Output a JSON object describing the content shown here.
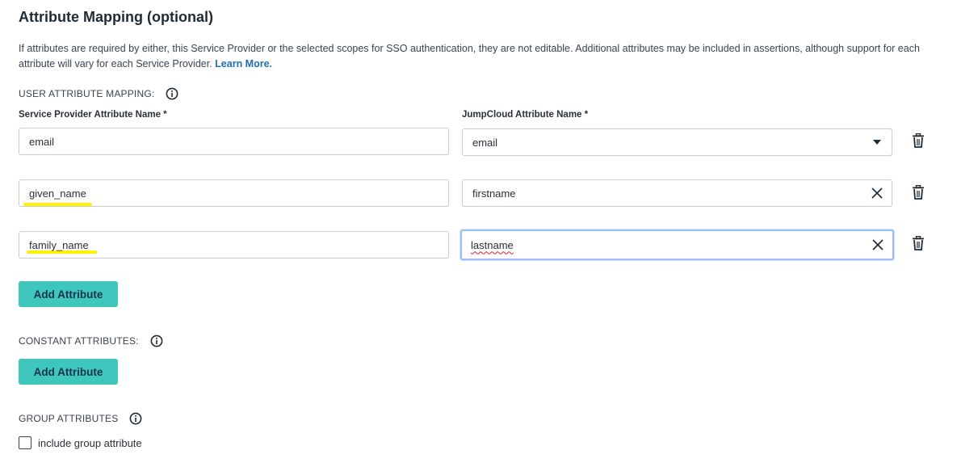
{
  "heading": "Attribute Mapping (optional)",
  "description": {
    "text": "If attributes are required by either, this Service Provider or the selected scopes for SSO authentication, they are not editable. Additional attributes may be included in assertions, although support for each attribute will vary for each Service Provider.",
    "link": "Learn More."
  },
  "user_mapping": {
    "label": "USER ATTRIBUTE MAPPING:",
    "sp_column_label": "Service Provider Attribute Name *",
    "jc_column_label": "JumpCloud Attribute Name *",
    "rows": [
      {
        "sp_value": "email",
        "jc_value": "email",
        "jc_control": "dropdown-caret-icon"
      },
      {
        "sp_value": "given_name",
        "jc_value": "firstname",
        "jc_control": "clear-x-icon"
      },
      {
        "sp_value": "family_name",
        "jc_value": "lastname",
        "jc_control": "clear-x-icon"
      }
    ],
    "add_button": "Add Attribute"
  },
  "constant_attributes": {
    "label": "CONSTANT ATTRIBUTES:",
    "add_button": "Add Attribute"
  },
  "group_attributes": {
    "label": "GROUP ATTRIBUTES",
    "checkbox_label": "include group attribute",
    "checked": false
  },
  "colors": {
    "button_bg": "#3fc6bd",
    "link": "#1f6fb2",
    "highlight": "#fff200",
    "focus_border": "#9bbcf0"
  }
}
